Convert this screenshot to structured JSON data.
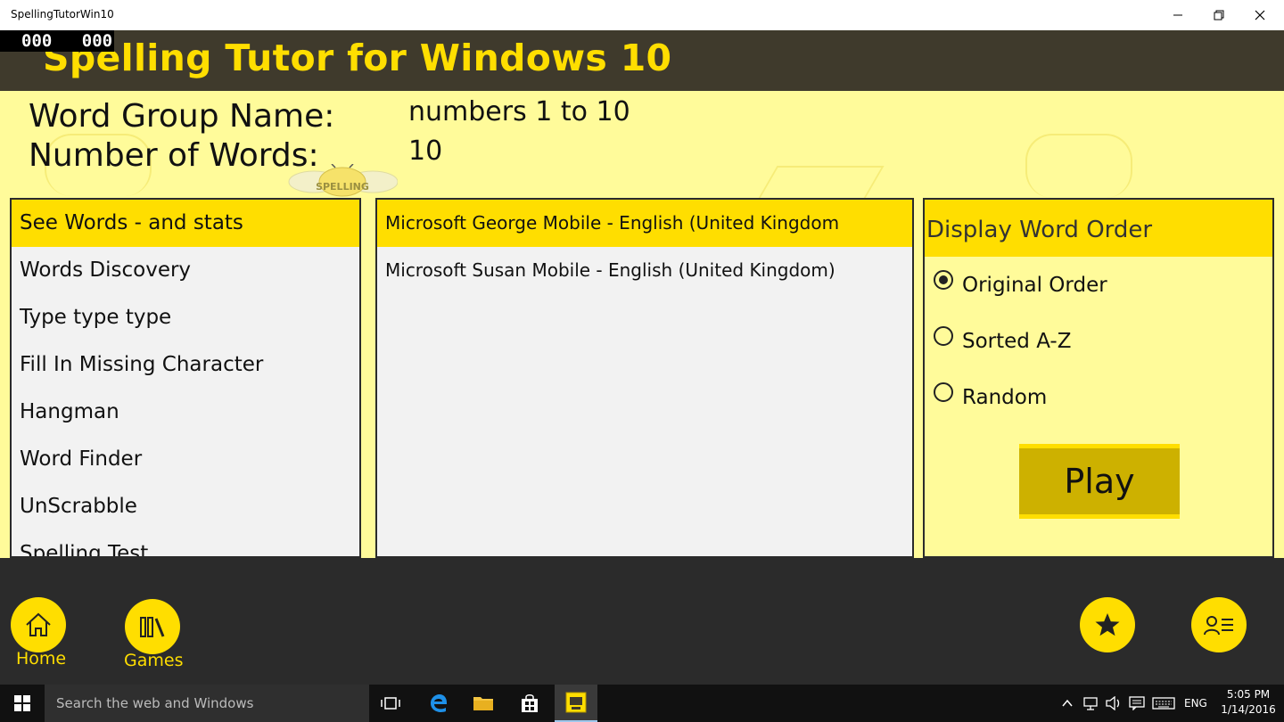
{
  "window": {
    "title": "SpellingTutorWin10",
    "fps_left": "000",
    "fps_right": "000"
  },
  "header": {
    "app_title": "Spelling Tutor for Windows 10"
  },
  "info": {
    "group_label": "Word Group Name:",
    "group_value": "numbers 1 to 10",
    "count_label": "Number of Words:",
    "count_value": "10",
    "logo_text": "SPELLING"
  },
  "activities": {
    "items": [
      {
        "label": "See Words - and stats",
        "selected": true
      },
      {
        "label": "Words Discovery",
        "selected": false
      },
      {
        "label": "Type type type",
        "selected": false
      },
      {
        "label": "Fill In Missing Character",
        "selected": false
      },
      {
        "label": "Hangman",
        "selected": false
      },
      {
        "label": "Word Finder",
        "selected": false
      },
      {
        "label": "UnScrabble",
        "selected": false
      },
      {
        "label": "Spelling Test",
        "selected": false
      }
    ]
  },
  "voices": {
    "items": [
      {
        "label": "Microsoft George Mobile - English (United Kingdom",
        "selected": true
      },
      {
        "label": "Microsoft Susan Mobile - English (United Kingdom)",
        "selected": false
      }
    ]
  },
  "word_order": {
    "header": "Display Word Order",
    "options": [
      {
        "label": "Original Order",
        "checked": true
      },
      {
        "label": "Sorted A-Z",
        "checked": false
      },
      {
        "label": "Random",
        "checked": false
      }
    ],
    "play_label": "Play"
  },
  "appbar": {
    "home_label": "Home",
    "games_label": "Games",
    "home_icon": "home-icon",
    "games_icon": "library-icon",
    "favorite_icon": "star-icon",
    "contact_icon": "contact-list-icon"
  },
  "taskbar": {
    "search_placeholder": "Search the web and Windows",
    "language": "ENG",
    "time": "5:05 PM",
    "date": "1/14/2016"
  },
  "colors": {
    "accent": "#ffde00",
    "background": "#fffb9a",
    "header_bg": "#3f3a2c",
    "appbar_bg": "#2b2b2b",
    "play_bg": "#cdb100"
  }
}
